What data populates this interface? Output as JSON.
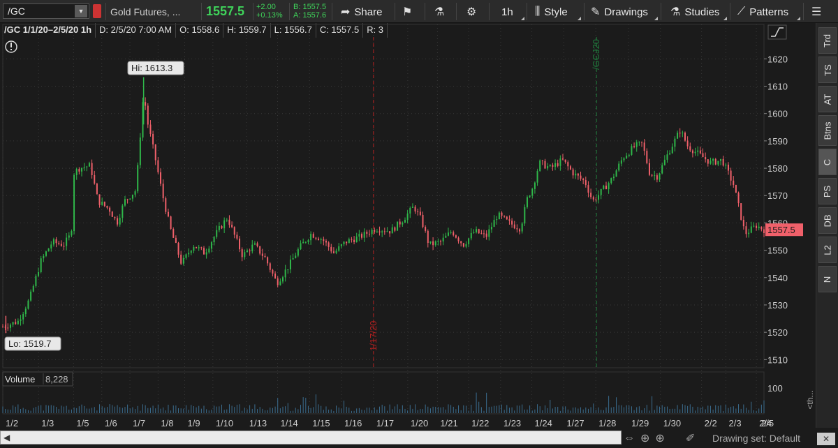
{
  "toolbar": {
    "symbol": "/GC",
    "description": "Gold Futures, ...",
    "last": "1557.5",
    "change": "+2.00",
    "change_pct": "+0.13%",
    "bid": "B: 1557.5",
    "ask": "A: 1557.6",
    "share_label": "Share",
    "interval_label": "1h",
    "style_label": "Style",
    "drawings_label": "Drawings",
    "studies_label": "Studies",
    "patterns_label": "Patterns"
  },
  "infobar": {
    "title": "/GC 1/1/20–2/5/20 1h",
    "date": "D: 2/5/20 7:00 AM",
    "open": "O: 1558.6",
    "high": "H: 1559.7",
    "low": "L: 1556.7",
    "close": "C: 1557.5",
    "range": "R: 3"
  },
  "chart_data": {
    "type": "candlestick",
    "price_ticks": [
      "1620",
      "1610",
      "1600",
      "1590",
      "1580",
      "1570",
      "1560",
      "1550",
      "1540",
      "1530",
      "1520",
      "1510"
    ],
    "price_tick_values": [
      1620,
      1610,
      1600,
      1590,
      1580,
      1570,
      1560,
      1550,
      1540,
      1530,
      1520,
      1510
    ],
    "ylim": [
      1506,
      1628
    ],
    "date_labels": [
      "1/2",
      "1/3",
      "1/5",
      "1/6",
      "1/7",
      "1/8",
      "1/9",
      "1/10",
      "1/13",
      "1/14",
      "1/15",
      "1/16",
      "1/17",
      "1/20",
      "1/21",
      "1/22",
      "1/23",
      "1/24",
      "1/27",
      "1/28",
      "1/29",
      "1/30",
      "2/2",
      "2/3",
      "2/4",
      "2/5"
    ],
    "date_positions": [
      0.0,
      0.047,
      0.093,
      0.13,
      0.167,
      0.204,
      0.239,
      0.276,
      0.32,
      0.361,
      0.403,
      0.445,
      0.487,
      0.532,
      0.571,
      0.612,
      0.654,
      0.695,
      0.737,
      0.779,
      0.822,
      0.864,
      0.918,
      0.95,
      0.99,
      1.02
    ],
    "price_path": [
      [
        0.0,
        1522
      ],
      [
        0.02,
        1524
      ],
      [
        0.035,
        1532
      ],
      [
        0.05,
        1546
      ],
      [
        0.065,
        1553
      ],
      [
        0.08,
        1552
      ],
      [
        0.09,
        1556
      ],
      [
        0.093,
        1578
      ],
      [
        0.1,
        1580
      ],
      [
        0.115,
        1581
      ],
      [
        0.125,
        1568
      ],
      [
        0.14,
        1565
      ],
      [
        0.15,
        1560
      ],
      [
        0.16,
        1568
      ],
      [
        0.175,
        1572
      ],
      [
        0.185,
        1608
      ],
      [
        0.19,
        1597
      ],
      [
        0.2,
        1584
      ],
      [
        0.21,
        1570
      ],
      [
        0.22,
        1558
      ],
      [
        0.235,
        1545
      ],
      [
        0.25,
        1552
      ],
      [
        0.265,
        1549
      ],
      [
        0.28,
        1556
      ],
      [
        0.295,
        1562
      ],
      [
        0.305,
        1555
      ],
      [
        0.315,
        1548
      ],
      [
        0.33,
        1552
      ],
      [
        0.345,
        1547
      ],
      [
        0.36,
        1538
      ],
      [
        0.375,
        1544
      ],
      [
        0.39,
        1551
      ],
      [
        0.405,
        1556
      ],
      [
        0.42,
        1554
      ],
      [
        0.435,
        1549
      ],
      [
        0.45,
        1553
      ],
      [
        0.47,
        1555
      ],
      [
        0.49,
        1558
      ],
      [
        0.51,
        1557
      ],
      [
        0.525,
        1561
      ],
      [
        0.54,
        1566
      ],
      [
        0.55,
        1561
      ],
      [
        0.56,
        1552
      ],
      [
        0.575,
        1553
      ],
      [
        0.59,
        1557
      ],
      [
        0.605,
        1552
      ],
      [
        0.62,
        1557
      ],
      [
        0.635,
        1555
      ],
      [
        0.65,
        1563
      ],
      [
        0.665,
        1560
      ],
      [
        0.68,
        1558
      ],
      [
        0.69,
        1570
      ],
      [
        0.695,
        1572
      ],
      [
        0.705,
        1582
      ],
      [
        0.72,
        1580
      ],
      [
        0.735,
        1583
      ],
      [
        0.75,
        1578
      ],
      [
        0.765,
        1575
      ],
      [
        0.775,
        1568
      ],
      [
        0.785,
        1571
      ],
      [
        0.8,
        1576
      ],
      [
        0.815,
        1584
      ],
      [
        0.83,
        1588
      ],
      [
        0.84,
        1589
      ],
      [
        0.85,
        1578
      ],
      [
        0.86,
        1577
      ],
      [
        0.875,
        1586
      ],
      [
        0.89,
        1594
      ],
      [
        0.9,
        1588
      ],
      [
        0.915,
        1585
      ],
      [
        0.93,
        1582
      ],
      [
        0.945,
        1583
      ],
      [
        0.96,
        1574
      ],
      [
        0.975,
        1556
      ],
      [
        0.99,
        1559
      ],
      [
        1.0,
        1557.5
      ]
    ],
    "high_label": "Hi: 1613.3",
    "low_label": "Lo: 1519.7",
    "current_price": 1557.5,
    "current_price_label": "1557.5",
    "vlines": [
      {
        "label": "1/17/20",
        "pos": 0.487,
        "color": "#b02020"
      },
      {
        "label": "/GCJ20",
        "pos": 0.78,
        "color": "#1f7a3c"
      }
    ],
    "volume_label": "Volume",
    "volume_value": "8,228",
    "volume_tick": "100",
    "up_color": "#2fb84a",
    "down_color": "#f0606a"
  },
  "right_tabs": [
    "Trd",
    "TS",
    "AT",
    "Btns",
    "C",
    "PS",
    "DB",
    "L2",
    "N"
  ],
  "bottom": {
    "drawing_set": "Drawing set: Default",
    "collapse_label": "<th..."
  }
}
